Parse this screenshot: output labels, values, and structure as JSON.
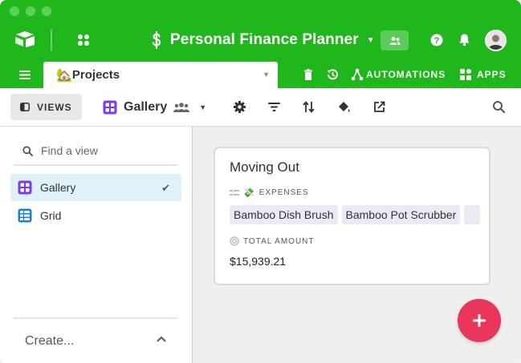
{
  "base": {
    "title": "Personal Finance Planner",
    "accent_color": "#1fb71c"
  },
  "table_tab": {
    "emoji": "🏡",
    "label": "Projects"
  },
  "tabbar": {
    "automations_label": "AUTOMATIONS",
    "apps_label": "APPS"
  },
  "viewbar": {
    "views_label": "VIEWS",
    "current_view": "Gallery"
  },
  "sidebar": {
    "search_placeholder": "Find a view",
    "views": [
      {
        "label": "Gallery",
        "icon": "gallery-view-icon",
        "color": "#7c3aed",
        "active": true
      },
      {
        "label": "Grid",
        "icon": "grid-view-icon",
        "color": "#1a7fd6",
        "active": false
      }
    ],
    "create_label": "Create..."
  },
  "gallery": {
    "cards": [
      {
        "title": "Moving Out",
        "expenses_label": "EXPENSES",
        "expenses_emoji": "💸",
        "expenses": [
          "Bamboo Dish Brush",
          "Bamboo Pot Scrubber"
        ],
        "total_label": "TOTAL AMOUNT",
        "total_value": "$15,939.21"
      }
    ]
  },
  "fab": {
    "icon": "plus-icon",
    "color": "#e8365d"
  }
}
